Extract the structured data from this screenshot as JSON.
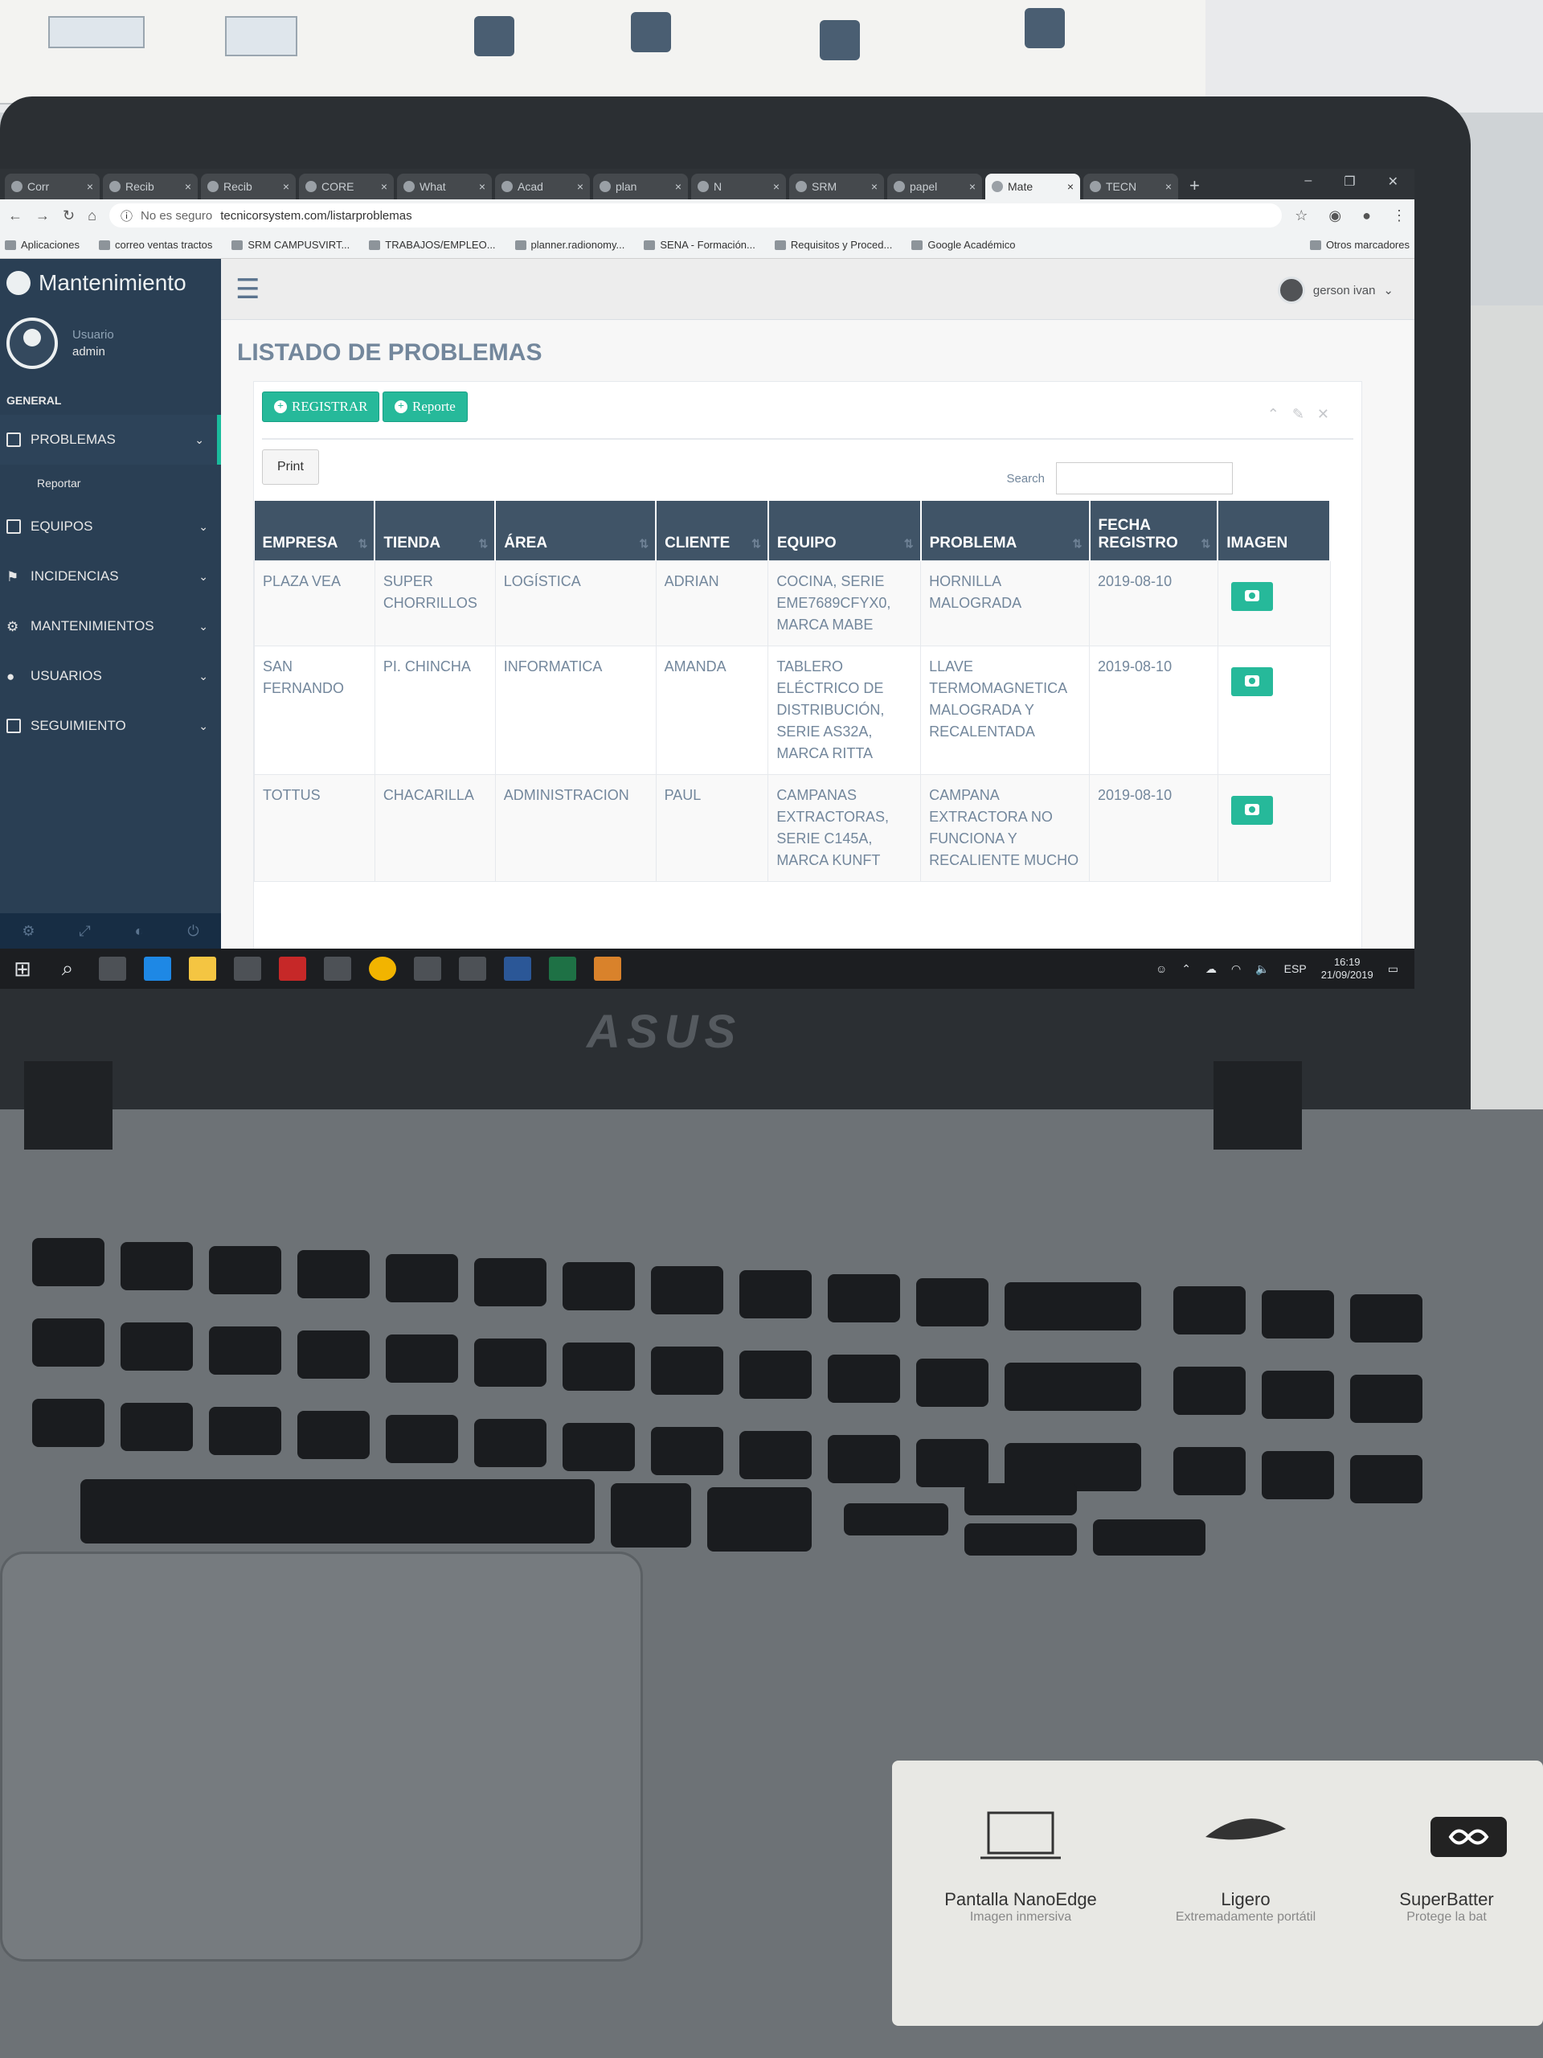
{
  "browser": {
    "tabs": [
      {
        "label": "Corr"
      },
      {
        "label": "Recib"
      },
      {
        "label": "Recib"
      },
      {
        "label": "CORE"
      },
      {
        "label": "What"
      },
      {
        "label": "Acad"
      },
      {
        "label": "plan"
      },
      {
        "label": "N"
      },
      {
        "label": "SRM"
      },
      {
        "label": "papel"
      },
      {
        "label": "Mate",
        "active": true
      },
      {
        "label": "TECN"
      }
    ],
    "security_label": "No es seguro",
    "url": "tecnicorsystem.com/listarproblemas",
    "bookmarks": [
      "Aplicaciones",
      "correo ventas tractos",
      "SRM CAMPUSVIRT...",
      "TRABAJOS/EMPLEO...",
      "planner.radionomy...",
      "SENA - Formación...",
      "Requisitos y Proced...",
      "Google Académico"
    ],
    "other_bookmarks": "Otros marcadores"
  },
  "sidebar": {
    "brand": "Mantenimiento",
    "welcome": "Usuario",
    "username": "admin",
    "section": "GENERAL",
    "items": [
      {
        "label": "PROBLEMAS",
        "icon": "file-icon"
      },
      {
        "label": "EQUIPOS",
        "icon": "file-icon"
      },
      {
        "label": "INCIDENCIAS",
        "icon": "flag-icon"
      },
      {
        "label": "MANTENIMIENTOS",
        "icon": "wrench-icon"
      },
      {
        "label": "USUARIOS",
        "icon": "user-icon"
      },
      {
        "label": "SEGUIMIENTO",
        "icon": "file-icon"
      }
    ],
    "submenu": [
      "Reportar"
    ]
  },
  "topnav": {
    "user": "gerson ivan"
  },
  "page": {
    "title": "LISTADO DE PROBLEMAS",
    "register_button": "REGISTRAR",
    "report_button": "Reporte",
    "print_button": "Print",
    "search_label": "Search"
  },
  "table": {
    "headers": [
      "EMPRESA",
      "TIENDA",
      "ÁREA",
      "CLIENTE",
      "EQUIPO",
      "PROBLEMA",
      "FECHA REGISTRO",
      "IMAGEN"
    ],
    "rows": [
      {
        "empresa": "PLAZA VEA",
        "tienda": "SUPER CHORRILLOS",
        "area": "LOGÍSTICA",
        "cliente": "ADRIAN",
        "equipo": "COCINA, SERIE EME7689CFYX0, MARCA MABE",
        "problema": "HORNILLA MALOGRADA",
        "fecha": "2019-08-10"
      },
      {
        "empresa": "SAN FERNANDO",
        "tienda": "PI. CHINCHA",
        "area": "INFORMATICA",
        "cliente": "AMANDA",
        "equipo": "TABLERO ELÉCTRICO DE DISTRIBUCIÓN, SERIE AS32A, MARCA RITTA",
        "problema": "LLAVE TERMOMAGNETICA MALOGRADA Y RECALENTADA",
        "fecha": "2019-08-10"
      },
      {
        "empresa": "TOTTUS",
        "tienda": "CHACARILLA",
        "area": "ADMINISTRACION",
        "cliente": "PAUL",
        "equipo": "CAMPANAS EXTRACTORAS, SERIE C145A, MARCA KUNFT",
        "problema": "CAMPANA EXTRACTORA NO FUNCIONA Y RECALIENTE MUCHO",
        "fecha": "2019-08-10"
      }
    ]
  },
  "taskbar": {
    "language": "ESP",
    "time": "16:19",
    "date": "21/09/2019"
  },
  "hardware": {
    "brand": "ASUS",
    "sticker": [
      {
        "title": "Pantalla NanoEdge",
        "subtitle": "Imagen inmersiva"
      },
      {
        "title": "Ligero",
        "subtitle": "Extremadamente portátil"
      },
      {
        "title": "SuperBatter",
        "subtitle": "Protege la bat"
      }
    ]
  },
  "colors": {
    "sidebar": "#2a3f54",
    "accent": "#26b99a",
    "table_header": "#405467",
    "text_muted": "#73879c"
  }
}
